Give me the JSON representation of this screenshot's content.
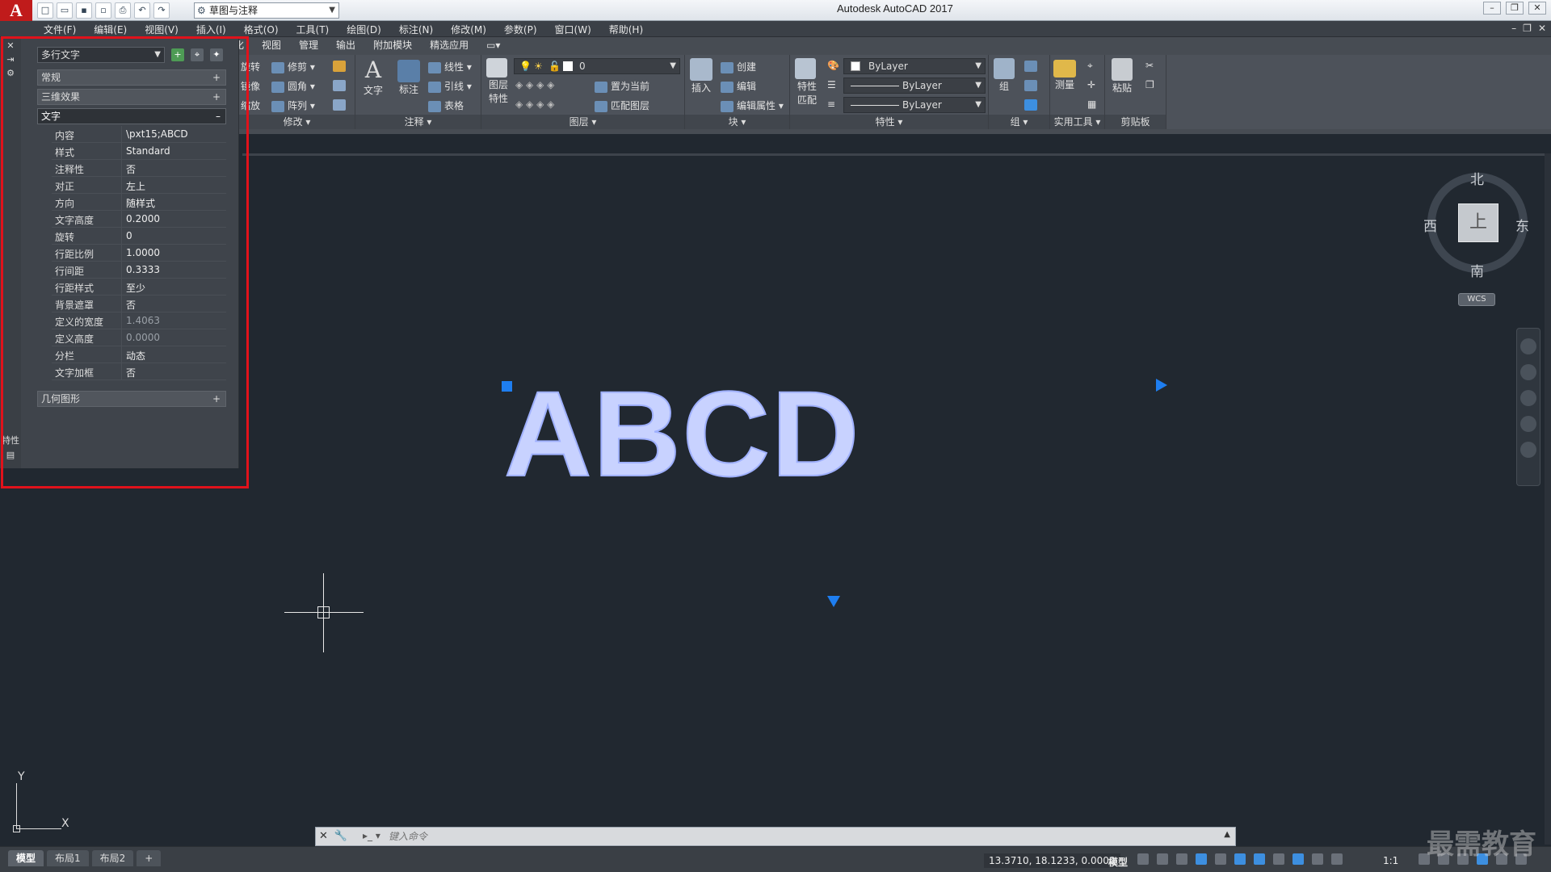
{
  "window": {
    "title": "Autodesk AutoCAD 2017",
    "workspace": "草图与注释"
  },
  "menubar": {
    "items": [
      "文件(F)",
      "编辑(E)",
      "视图(V)",
      "插入(I)",
      "格式(O)",
      "工具(T)",
      "绘图(D)",
      "标注(N)",
      "修改(M)",
      "参数(P)",
      "窗口(W)",
      "帮助(H)"
    ]
  },
  "ribbon": {
    "tabs": [
      "化",
      "视图",
      "管理",
      "输出",
      "附加模块",
      "精选应用"
    ],
    "modify": {
      "title": "修改",
      "rotate": "旋转",
      "trim": "修剪",
      "mirror": "镜像",
      "fillet": "圆角",
      "scale": "缩放",
      "array": "阵列"
    },
    "annotation": {
      "title": "注释",
      "text": "文字",
      "dimension": "标注",
      "linear": "线性",
      "leader": "引线",
      "table": "表格"
    },
    "layers": {
      "title": "图层",
      "layer_props": "图层特性",
      "layer_name": "0",
      "set_current": "置为当前",
      "match_layer": "匹配图层"
    },
    "block": {
      "title": "块",
      "insert": "插入",
      "create": "创建",
      "edit": "编辑",
      "edit_attr": "编辑属性"
    },
    "properties": {
      "title": "特性",
      "match": "特性匹配",
      "color": "ByLayer",
      "linetype": "ByLayer",
      "lineweight": "ByLayer"
    },
    "groups": {
      "title": "组",
      "group": "组"
    },
    "utilities": {
      "title": "实用工具",
      "measure": "测量"
    },
    "clipboard": {
      "title": "剪贴板",
      "paste": "粘贴"
    }
  },
  "properties_palette": {
    "object_type": "多行文字",
    "sections": {
      "general": "常规",
      "3d": "三维效果",
      "text": "文字",
      "geometry": "几何图形"
    },
    "rows": [
      {
        "key": "内容",
        "value": "\\pxt15;ABCD",
        "dim": false
      },
      {
        "key": "样式",
        "value": "Standard",
        "dim": false
      },
      {
        "key": "注释性",
        "value": "否",
        "dim": false
      },
      {
        "key": "对正",
        "value": "左上",
        "dim": false
      },
      {
        "key": "方向",
        "value": "随样式",
        "dim": false
      },
      {
        "key": "文字高度",
        "value": "0.2000",
        "dim": false
      },
      {
        "key": "旋转",
        "value": "0",
        "dim": false
      },
      {
        "key": "行距比例",
        "value": "1.0000",
        "dim": false
      },
      {
        "key": "行间距",
        "value": "0.3333",
        "dim": false
      },
      {
        "key": "行距样式",
        "value": "至少",
        "dim": false
      },
      {
        "key": "背景遮罩",
        "value": "否",
        "dim": false
      },
      {
        "key": "定义的宽度",
        "value": "1.4063",
        "dim": true
      },
      {
        "key": "定义高度",
        "value": "0.0000",
        "dim": true
      },
      {
        "key": "分栏",
        "value": "动态",
        "dim": false
      },
      {
        "key": "文字加框",
        "value": "否",
        "dim": false
      }
    ],
    "side_label": "特性"
  },
  "drawing": {
    "mtext": "ABCD"
  },
  "viewcube": {
    "north": "北",
    "south": "南",
    "east": "东",
    "west": "西",
    "face": "上",
    "wcs": "WCS"
  },
  "ucs": {
    "x": "X",
    "y": "Y"
  },
  "command": {
    "placeholder": "键入命令"
  },
  "status": {
    "layouts": [
      "模型",
      "布局1",
      "布局2",
      "+"
    ],
    "coords": "13.3710, 18.1233, 0.0000",
    "model": "模型",
    "scale": "1:1"
  },
  "watermark": "最需教育"
}
